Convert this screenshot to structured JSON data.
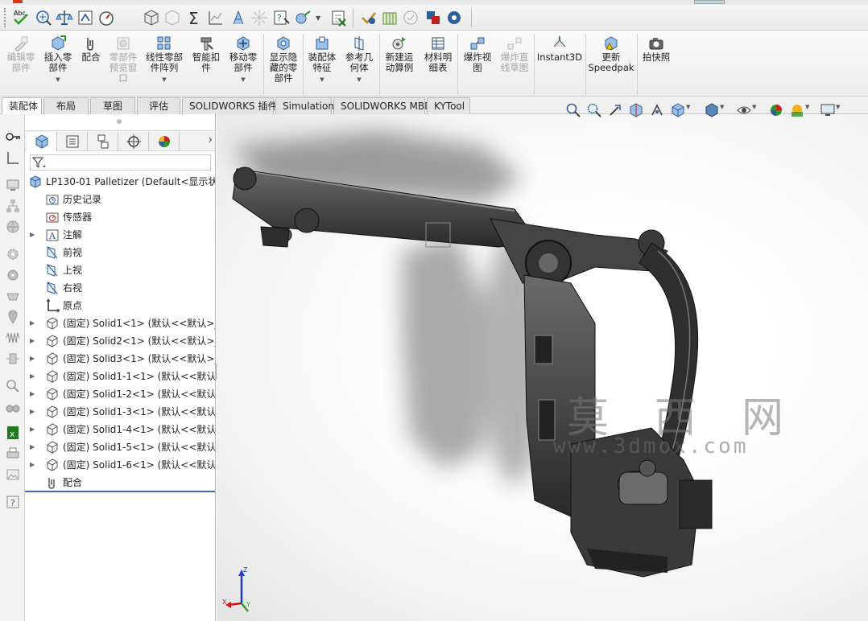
{
  "colors": {
    "accent": "#3a6ea5",
    "toolbar_bg": "#efefef",
    "model_dark": "#3b3b3b",
    "watermark": "#7a7a7a"
  },
  "top_toolbar": {
    "icons": [
      "spell-check-icon",
      "measure-icon",
      "mass-properties-icon",
      "section-properties-icon",
      "performance-icon",
      "component-appearance-icon",
      "hide-icon",
      "sum-icon",
      "graph-icon",
      "rebuild-icon",
      "simulation-icon",
      "reference-icon",
      "options-icon",
      "excel-icon",
      "check-icon",
      "property-icon",
      "circle-check-icon",
      "color-icon",
      "settings-icon"
    ],
    "spell_label": "Abc"
  },
  "ribbon": {
    "items": [
      {
        "label": "编辑零\n部件",
        "icon": "edit-component-icon",
        "enabled": false,
        "dropdown": false
      },
      {
        "label": "插入零\n部件",
        "icon": "insert-component-icon",
        "enabled": true,
        "dropdown": true
      },
      {
        "label": "配合",
        "icon": "mate-icon",
        "enabled": true,
        "dropdown": false
      },
      {
        "label": "零部件\n预览窗\n口",
        "icon": "component-preview-icon",
        "enabled": false,
        "dropdown": false
      },
      {
        "label": "线性零部\n件阵列",
        "icon": "linear-pattern-icon",
        "enabled": true,
        "dropdown": true
      },
      {
        "label": "智能扣\n件",
        "icon": "smart-fasteners-icon",
        "enabled": true,
        "dropdown": false
      },
      {
        "label": "移动零\n部件",
        "icon": "move-component-icon",
        "enabled": true,
        "dropdown": true
      },
      {
        "label": "显示隐\n藏的零\n部件",
        "icon": "show-hidden-icon",
        "enabled": true,
        "dropdown": false
      },
      {
        "label": "装配体\n特征",
        "icon": "assembly-features-icon",
        "enabled": true,
        "dropdown": true
      },
      {
        "label": "参考几\n何体",
        "icon": "reference-geometry-icon",
        "enabled": true,
        "dropdown": true
      },
      {
        "label": "新建运\n动算例",
        "icon": "new-motion-study-icon",
        "enabled": true,
        "dropdown": false
      },
      {
        "label": "材料明\n细表",
        "icon": "bill-of-materials-icon",
        "enabled": true,
        "dropdown": false
      },
      {
        "label": "爆炸视\n图",
        "icon": "exploded-view-icon",
        "enabled": true,
        "dropdown": false
      },
      {
        "label": "爆炸直\n线草图",
        "icon": "explode-line-sketch-icon",
        "enabled": false,
        "dropdown": false
      },
      {
        "label": "Instant3D",
        "icon": "instant3d-icon",
        "enabled": true,
        "dropdown": false
      },
      {
        "label": "更新\nSpeedpak",
        "icon": "speedpak-icon",
        "enabled": true,
        "dropdown": false
      },
      {
        "label": "拍快照",
        "icon": "snapshot-icon",
        "enabled": true,
        "dropdown": false
      }
    ]
  },
  "tabs": [
    {
      "label": "装配体",
      "active": true
    },
    {
      "label": "布局",
      "active": false
    },
    {
      "label": "草图",
      "active": false
    },
    {
      "label": "评估",
      "active": false
    },
    {
      "label": "SOLIDWORKS 插件",
      "active": false
    },
    {
      "label": "Simulation",
      "active": false
    },
    {
      "label": "SOLIDWORKS MBD",
      "active": false
    },
    {
      "label": "KYTool",
      "active": false
    }
  ],
  "feature_tree": {
    "panel_tabs": [
      "feature-manager-icon",
      "property-manager-icon",
      "configuration-manager-icon",
      "dimxpert-icon",
      "display-manager-icon"
    ],
    "nodes": [
      {
        "text": "LP130-01 Palletizer  (Default<显示状",
        "icon": "assembly-icon",
        "expandable": false,
        "indent": 0
      },
      {
        "text": "历史记录",
        "icon": "history-icon",
        "expandable": false,
        "indent": 1
      },
      {
        "text": "传感器",
        "icon": "sensor-icon",
        "expandable": false,
        "indent": 1
      },
      {
        "text": "注解",
        "icon": "annotation-icon",
        "expandable": true,
        "indent": 1
      },
      {
        "text": "前视",
        "icon": "plane-icon",
        "expandable": false,
        "indent": 1
      },
      {
        "text": "上视",
        "icon": "plane-icon",
        "expandable": false,
        "indent": 1
      },
      {
        "text": "右视",
        "icon": "plane-icon",
        "expandable": false,
        "indent": 1
      },
      {
        "text": "原点",
        "icon": "origin-icon",
        "expandable": false,
        "indent": 1
      },
      {
        "text": "(固定) Solid1<1> (默认<<默认>_",
        "icon": "part-icon",
        "expandable": true,
        "indent": 1
      },
      {
        "text": "(固定) Solid2<1> (默认<<默认>_",
        "icon": "part-icon",
        "expandable": true,
        "indent": 1
      },
      {
        "text": "(固定) Solid3<1> (默认<<默认>_",
        "icon": "part-icon",
        "expandable": true,
        "indent": 1
      },
      {
        "text": "(固定) Solid1-1<1> (默认<<默认:",
        "icon": "part-icon",
        "expandable": true,
        "indent": 1
      },
      {
        "text": "(固定) Solid1-2<1> (默认<<默认:",
        "icon": "part-icon",
        "expandable": true,
        "indent": 1
      },
      {
        "text": "(固定) Solid1-3<1> (默认<<默认:",
        "icon": "part-icon",
        "expandable": true,
        "indent": 1
      },
      {
        "text": "(固定) Solid1-4<1> (默认<<默认:",
        "icon": "part-icon",
        "expandable": true,
        "indent": 1
      },
      {
        "text": "(固定) Solid1-5<1> (默认<<默认:",
        "icon": "part-icon",
        "expandable": true,
        "indent": 1
      },
      {
        "text": "(固定) Solid1-6<1> (默认<<默认:",
        "icon": "part-icon",
        "expandable": true,
        "indent": 1
      },
      {
        "text": "配合",
        "icon": "mates-folder-icon",
        "expandable": false,
        "indent": 1
      }
    ]
  },
  "viewport": {
    "watermark_main": "莫 西 网",
    "watermark_url": "www.3dmox.com",
    "triad": {
      "x": "X",
      "y": "Y",
      "z": "Z"
    },
    "heads_up_icons": [
      "zoom-to-fit-icon",
      "zoom-to-area-icon",
      "previous-view-icon",
      "section-view-icon",
      "dynamic-annotation-icon",
      "view-orientation-icon",
      "display-style-icon",
      "hide-show-icon",
      "edit-appearance-icon",
      "apply-scene-icon",
      "view-settings-icon",
      "monitor-icon"
    ]
  }
}
